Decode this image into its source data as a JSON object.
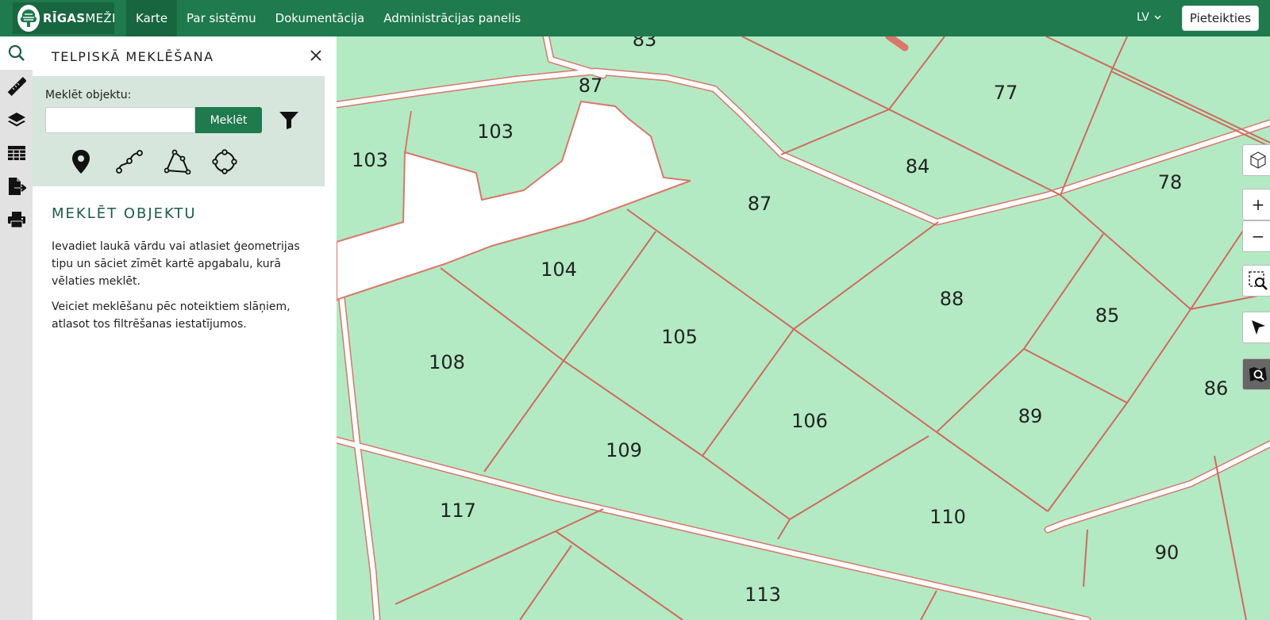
{
  "app": {
    "logo_text_bold": "RĪGAS",
    "logo_text_light": "MEŽI"
  },
  "nav": {
    "items": [
      {
        "label": "Karte",
        "active": true
      },
      {
        "label": "Par sistēmu",
        "active": false
      },
      {
        "label": "Dokumentācija",
        "active": false
      },
      {
        "label": "Administrācijas panelis",
        "active": false
      }
    ],
    "language": "LV",
    "login_label": "Pieteikties"
  },
  "toolbar": {
    "tools": [
      {
        "icon": "search-icon",
        "active": true
      },
      {
        "icon": "ruler-icon",
        "active": false
      },
      {
        "icon": "layers-icon",
        "active": false
      },
      {
        "icon": "table-icon",
        "active": false
      },
      {
        "icon": "export-icon",
        "active": false
      },
      {
        "icon": "print-icon",
        "active": false
      }
    ]
  },
  "panel": {
    "title": "TELPISKĀ MEKLĒŠANA",
    "search_label": "Meklēt objektu:",
    "search_value": "",
    "search_button": "Meklēt",
    "geometry_tools": [
      "point-icon",
      "line-icon",
      "polygon-icon",
      "circle-icon"
    ],
    "section_title": "MEKLĒT OBJEKTU",
    "description_1": "Ievadiet laukā vārdu vai atlasiet ģeometrijas tipu un sāciet zīmēt kartē apgabalu, kurā vēlaties meklēt.",
    "description_2": "Veiciet meklēšanu pēc noteiktiem slāņiem, atlasot tos filtrēšanas iestatījumos."
  },
  "map": {
    "colors": {
      "parcel_fill": "#b3eac3",
      "parcel_border": "#d9776b",
      "road": "#fdfdfd"
    },
    "parcels": [
      "83",
      "87",
      "77",
      "103",
      "103",
      "84",
      "78",
      "87",
      "104",
      "88",
      "85",
      "105",
      "108",
      "86",
      "106",
      "89",
      "109",
      "117",
      "110",
      "90",
      "113"
    ],
    "controls": [
      "cube-icon",
      "zoom-in",
      "zoom-out",
      "zoom-area-icon",
      "select-pointer-icon",
      "map-overview-icon"
    ],
    "zoom_in_label": "+",
    "zoom_out_label": "−"
  }
}
